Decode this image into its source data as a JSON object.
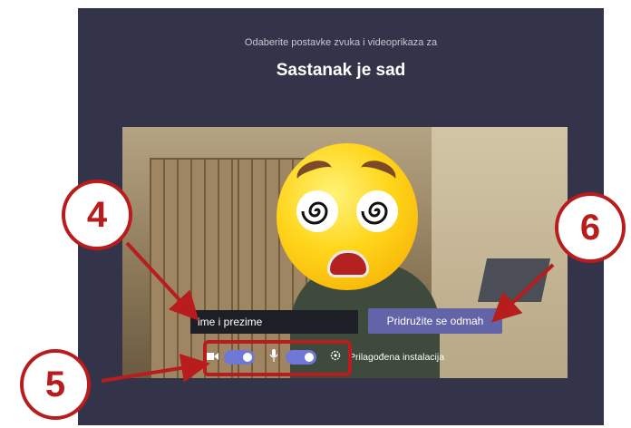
{
  "dialog": {
    "subtitle": "Odaberite postavke zvuka i videoprikaza za",
    "title": "Sastanak je sad"
  },
  "name_input": {
    "value": "ime i prezime"
  },
  "join_button": {
    "label": "Pridružite se odmah"
  },
  "controls": {
    "camera_icon": "video-camera-icon",
    "camera_toggle_on": true,
    "mic_icon": "microphone-icon",
    "mic_toggle_on": true,
    "custom_setup_icon": "gear-icon",
    "custom_setup_label": "Prilagođena instalacija"
  },
  "callouts": [
    "4",
    "5",
    "6"
  ],
  "colors": {
    "panel": "#33344a",
    "accent": "#6264a7",
    "toggle": "#6f78d6",
    "callout": "#b81c1c"
  }
}
